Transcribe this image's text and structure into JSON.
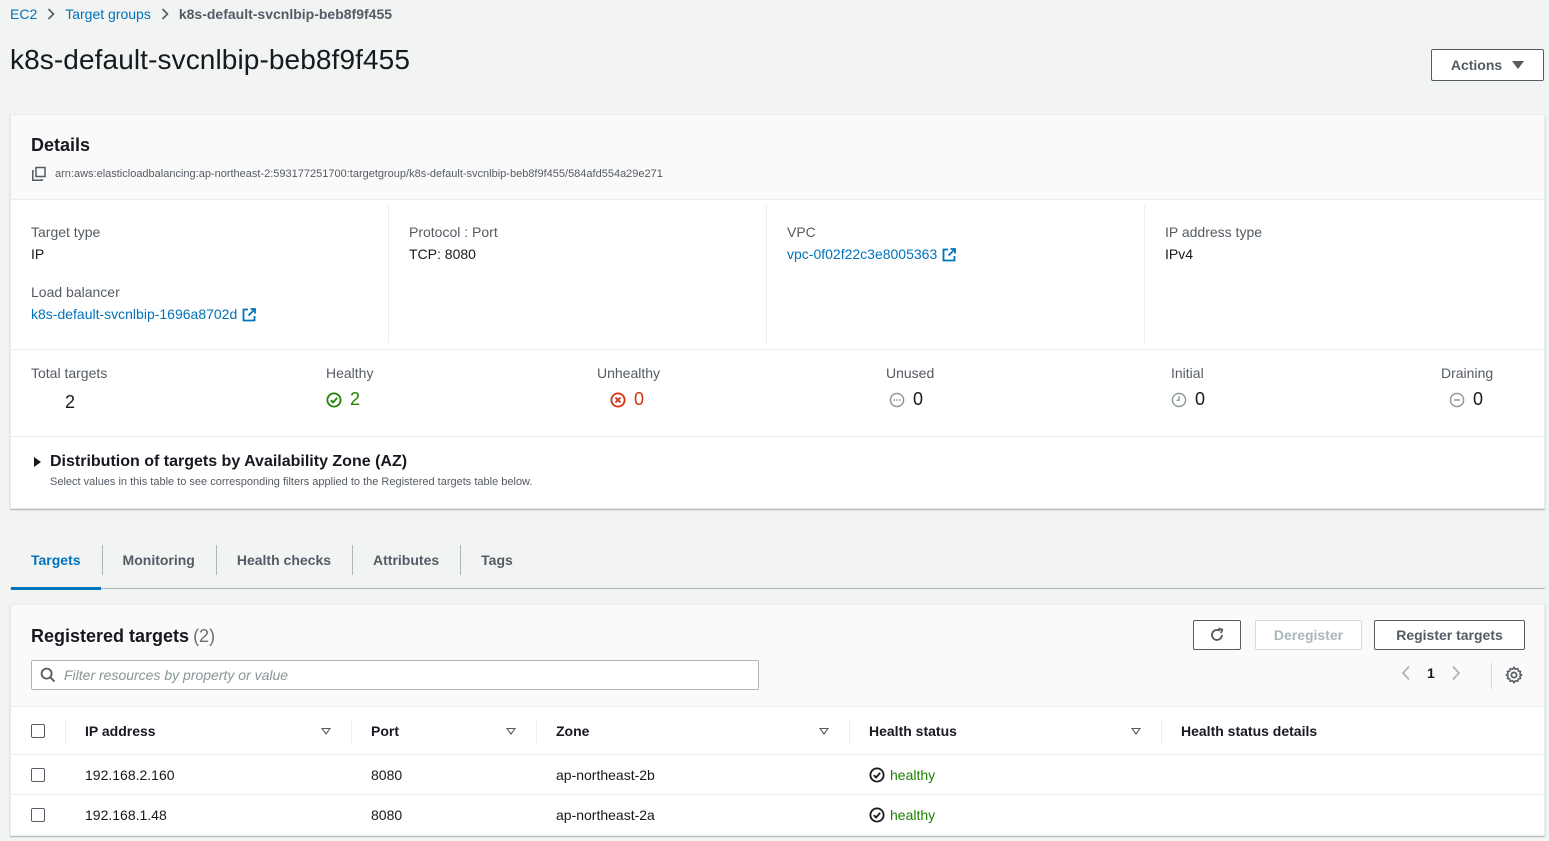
{
  "breadcrumb": {
    "items": [
      "EC2",
      "Target groups"
    ],
    "current": "k8s-default-svcnlbip-beb8f9f455"
  },
  "page": {
    "title": "k8s-default-svcnlbip-beb8f9f455",
    "actions_label": "Actions"
  },
  "details": {
    "title": "Details",
    "arn": "arn:aws:elasticloadbalancing:ap-northeast-2:593177251700:targetgroup/k8s-default-svcnlbip-beb8f9f455/584afd554a29e271",
    "target_type_label": "Target type",
    "target_type": "IP",
    "load_balancer_label": "Load balancer",
    "load_balancer": "k8s-default-svcnlbip-1696a8702d",
    "protocol_port_label": "Protocol : Port",
    "protocol_port": "TCP: 8080",
    "vpc_label": "VPC",
    "vpc": "vpc-0f02f22c3e8005363",
    "ip_type_label": "IP address type",
    "ip_type": "IPv4"
  },
  "counts": {
    "total_label": "Total targets",
    "total": "2",
    "healthy_label": "Healthy",
    "healthy": "2",
    "unhealthy_label": "Unhealthy",
    "unhealthy": "0",
    "unused_label": "Unused",
    "unused": "0",
    "initial_label": "Initial",
    "initial": "0",
    "draining_label": "Draining",
    "draining": "0"
  },
  "distribution": {
    "title": "Distribution of targets by Availability Zone (AZ)",
    "description": "Select values in this table to see corresponding filters applied to the Registered targets table below."
  },
  "tabs": [
    "Targets",
    "Monitoring",
    "Health checks",
    "Attributes",
    "Tags"
  ],
  "registered": {
    "title": "Registered targets",
    "count": "(2)",
    "deregister_label": "Deregister",
    "register_label": "Register targets",
    "search_placeholder": "Filter resources by property or value",
    "page": "1",
    "columns": [
      "IP address",
      "Port",
      "Zone",
      "Health status",
      "Health status details"
    ],
    "rows": [
      {
        "ip": "192.168.2.160",
        "port": "8080",
        "zone": "ap-northeast-2b",
        "status": "healthy",
        "details": ""
      },
      {
        "ip": "192.168.1.48",
        "port": "8080",
        "zone": "ap-northeast-2a",
        "status": "healthy",
        "details": ""
      }
    ]
  },
  "colors": {
    "link": "#0073bb",
    "healthy": "#1d8102",
    "unhealthy": "#d13212",
    "background": "#f2f3f3"
  }
}
